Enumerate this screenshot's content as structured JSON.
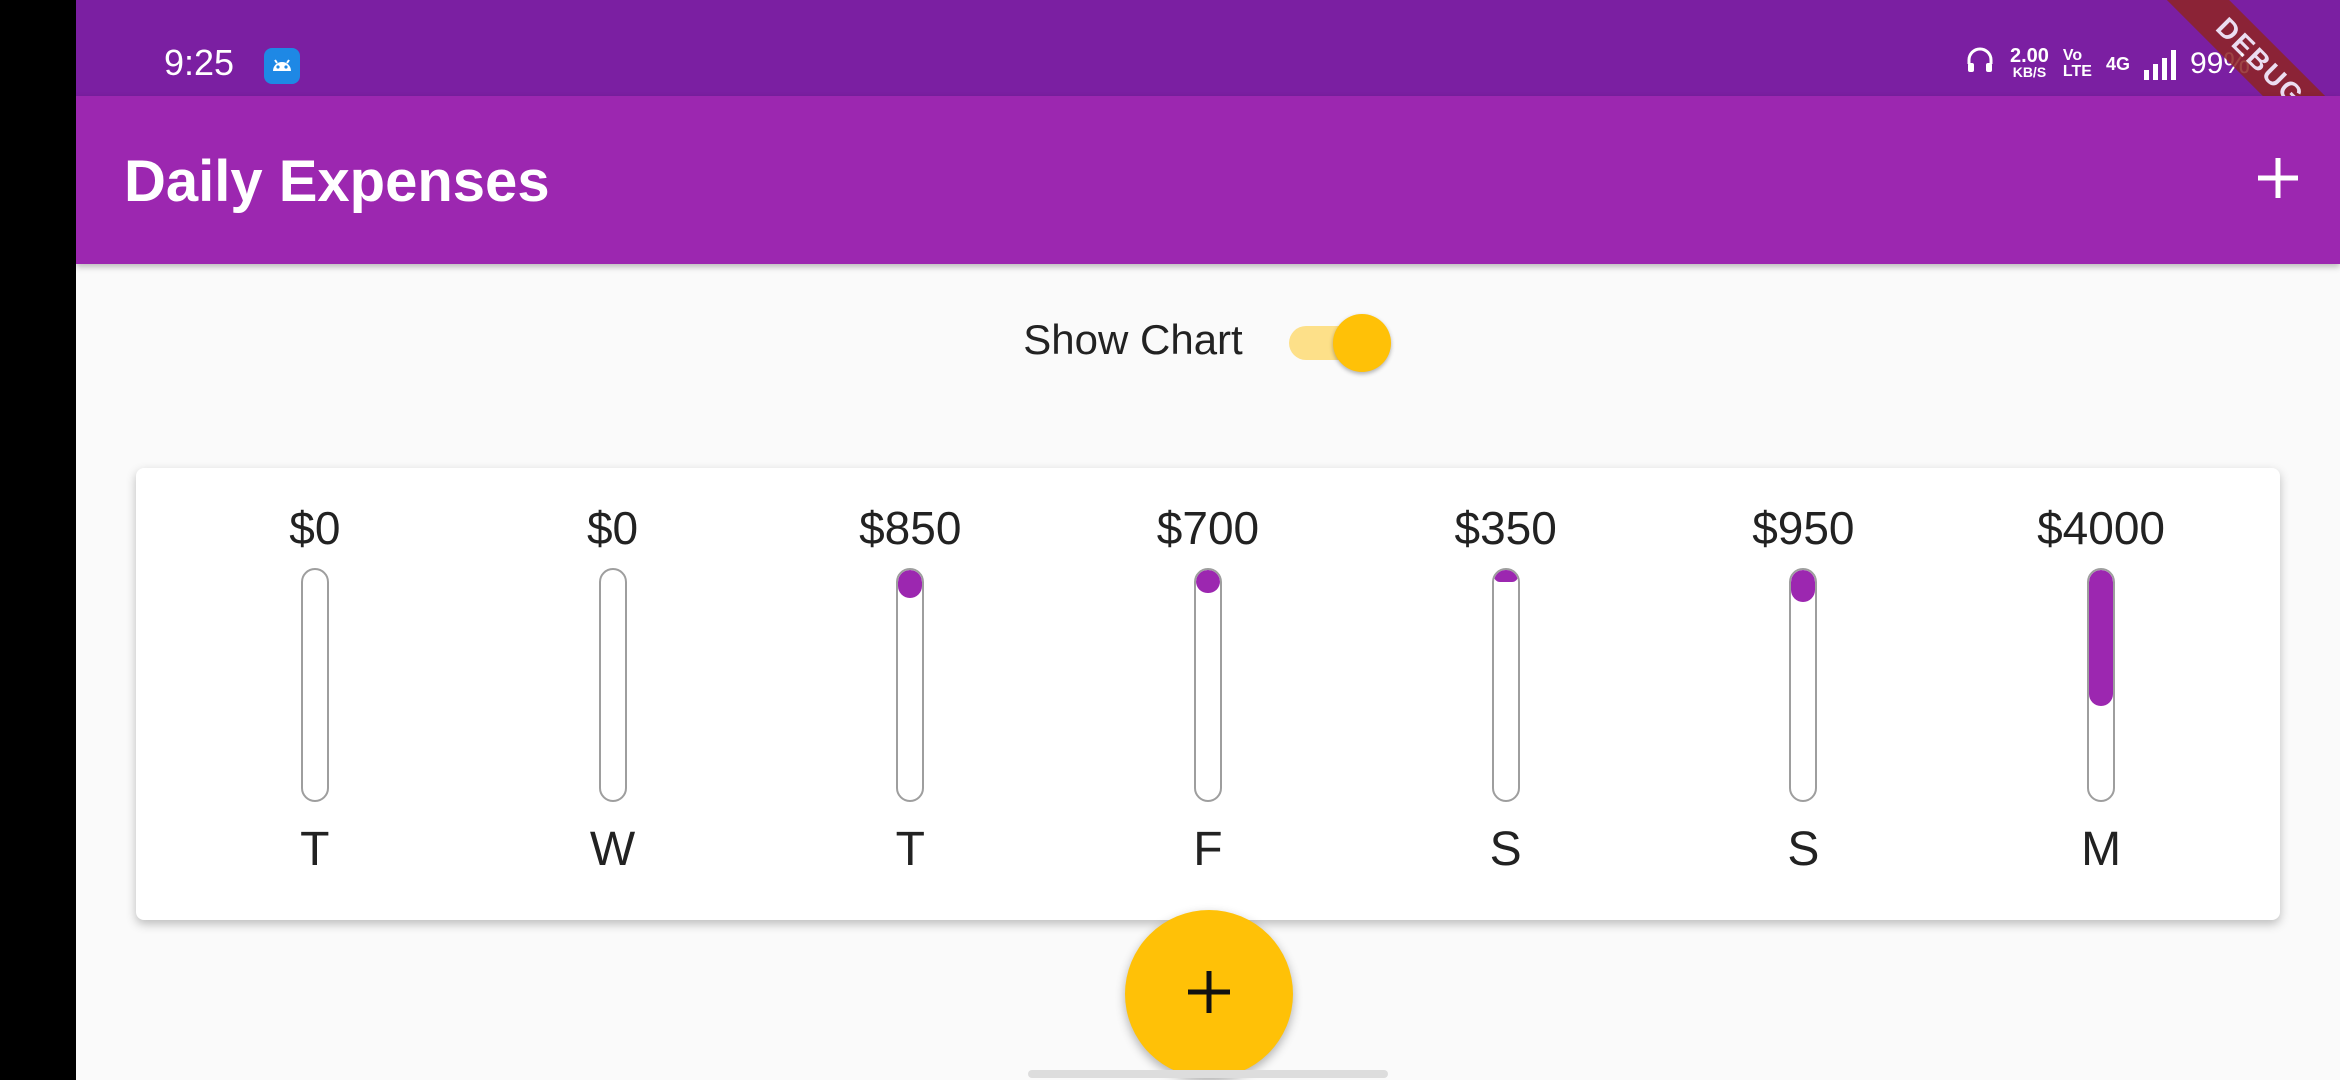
{
  "status_bar": {
    "time": "9:25",
    "net_speed": "2.00",
    "net_unit": "KB/S",
    "volte_top": "Vo",
    "volte_bottom": "LTE",
    "network": "4G",
    "battery": "99%",
    "icons": [
      "android-app-icon",
      "headphones-icon",
      "signal-icon"
    ]
  },
  "debug_banner": "DEBUG",
  "app_bar": {
    "title": "Daily Expenses",
    "add_icon": "plus-icon"
  },
  "toggle": {
    "label": "Show Chart",
    "on": true
  },
  "chart_data": {
    "type": "bar",
    "categories": [
      "T",
      "W",
      "T",
      "F",
      "S",
      "S",
      "M"
    ],
    "labels": [
      "$0",
      "$0",
      "$850",
      "$700",
      "$350",
      "$950",
      "$4000"
    ],
    "values": [
      0,
      0,
      850,
      700,
      350,
      950,
      4000
    ],
    "fill_fraction": [
      0,
      0,
      0.12,
      0.1,
      0.05,
      0.14,
      0.59
    ],
    "colors": {
      "fill": "#9c27b0",
      "track_border": "#9e9e9e"
    }
  },
  "fab": {
    "icon": "plus-icon",
    "color": "#ffc107"
  },
  "colors": {
    "primary": "#9c27b0",
    "primary_dark": "#7b1fa2",
    "accent": "#ffc107"
  }
}
